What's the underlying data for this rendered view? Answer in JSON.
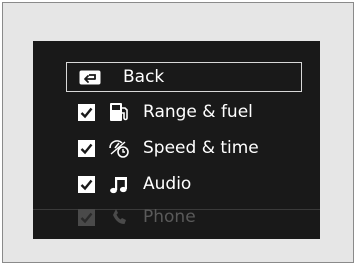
{
  "menu": {
    "back_label": "Back",
    "items": [
      {
        "label": "Range & fuel",
        "checked": true,
        "icon": "fuel-pump-icon",
        "enabled": true
      },
      {
        "label": "Speed & time",
        "checked": true,
        "icon": "speedometer-clock-icon",
        "enabled": true
      },
      {
        "label": "Audio",
        "checked": true,
        "icon": "music-note-icon",
        "enabled": true
      },
      {
        "label": "Phone",
        "checked": true,
        "icon": "phone-icon",
        "enabled": false
      }
    ]
  },
  "colors": {
    "screen_background": "#191919",
    "frame_background": "#e6e6e6",
    "text": "#ffffff",
    "dimmed_text": "#5a5a5a"
  }
}
